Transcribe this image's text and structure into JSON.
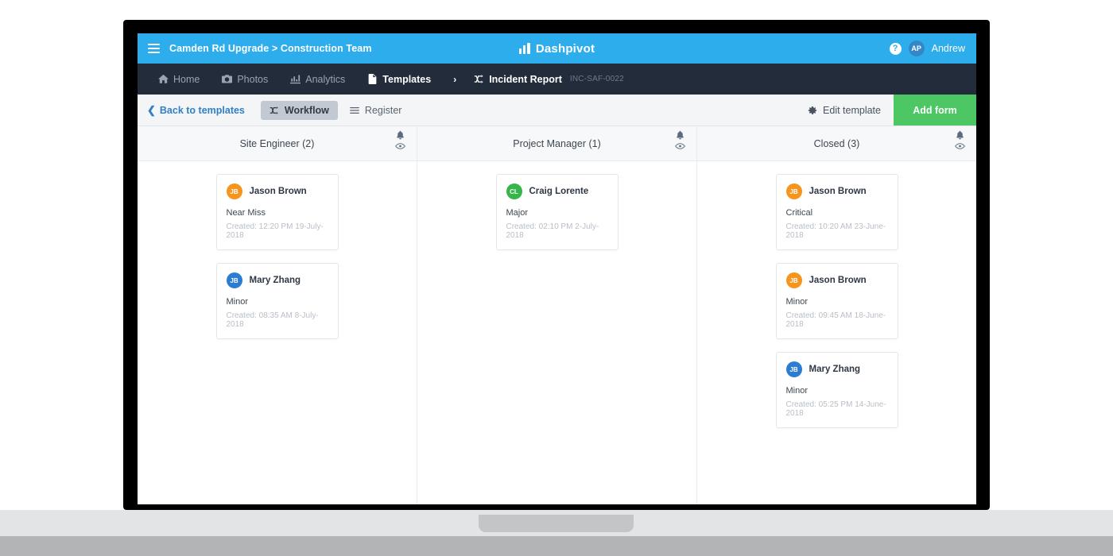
{
  "topbar": {
    "menu_icon": "hamburger-icon",
    "breadcrumb": "Camden Rd Upgrade > Construction Team",
    "brand": "Dashpivot",
    "brand_icon": "bar-chart-logo-icon",
    "help_icon_label": "?",
    "avatar_initials": "AP",
    "user_name": "Andrew"
  },
  "nav": {
    "items": [
      {
        "label": "Home",
        "icon": "home-icon",
        "active": false
      },
      {
        "label": "Photos",
        "icon": "camera-icon",
        "active": false
      },
      {
        "label": "Analytics",
        "icon": "chart-icon",
        "active": false
      },
      {
        "label": "Templates",
        "icon": "document-icon",
        "active": true
      }
    ],
    "separator": "›",
    "current": {
      "label": "Incident Report",
      "icon": "shuffle-icon"
    },
    "code": "INC-SAF-0022"
  },
  "toolbar": {
    "back_label": "Back to templates",
    "back_icon": "chevron-left-icon",
    "tabs": [
      {
        "label": "Workflow",
        "icon": "shuffle-icon",
        "active": true
      },
      {
        "label": "Register",
        "icon": "list-icon",
        "active": false
      }
    ],
    "edit_template_label": "Edit template",
    "edit_template_icon": "gear-icon",
    "add_form_label": "Add form"
  },
  "board": {
    "columns": [
      {
        "title": "Site Engineer (2)",
        "bell_icon": "bell-icon",
        "eye_icon": "eye-icon",
        "cards": [
          {
            "initials": "JB",
            "avatar_color": "#f7941e",
            "name": "Jason Brown",
            "severity": "Near Miss",
            "created": "Created: 12:20 PM 19-July-2018"
          },
          {
            "initials": "JB",
            "avatar_color": "#2b7cd3",
            "name": "Mary Zhang",
            "severity": "Minor",
            "created": "Created: 08:35 AM 8-July-2018"
          }
        ]
      },
      {
        "title": "Project Manager (1)",
        "bell_icon": "bell-icon",
        "eye_icon": "eye-icon",
        "cards": [
          {
            "initials": "CL",
            "avatar_color": "#36b54a",
            "name": "Craig Lorente",
            "severity": "Major",
            "created": "Created: 02:10 PM 2-July-2018"
          }
        ]
      },
      {
        "title": "Closed (3)",
        "bell_icon": "bell-icon",
        "eye_icon": "eye-icon",
        "cards": [
          {
            "initials": "JB",
            "avatar_color": "#f7941e",
            "name": "Jason Brown",
            "severity": "Critical",
            "created": "Created: 10:20 AM 23-June-2018"
          },
          {
            "initials": "JB",
            "avatar_color": "#f7941e",
            "name": "Jason Brown",
            "severity": "Minor",
            "created": "Created: 09:45 AM 18-June-2018"
          },
          {
            "initials": "JB",
            "avatar_color": "#2b7cd3",
            "name": "Mary Zhang",
            "severity": "Minor",
            "created": "Created: 05:25 PM 14-June-2018"
          }
        ]
      }
    ]
  },
  "colors": {
    "topbar_blue": "#2eadec",
    "nav_dark": "#232c3b",
    "accent_green": "#4cc764",
    "link_blue": "#2f80c4"
  }
}
